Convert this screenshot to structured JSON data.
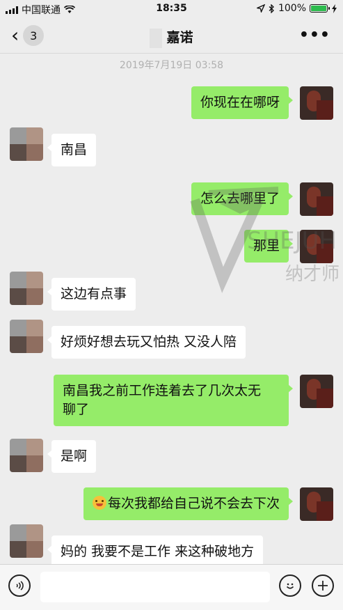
{
  "status_bar": {
    "carrier": "中国联通",
    "time": "18:35",
    "battery": "100%",
    "icons": [
      "signal-icon",
      "wifi-icon",
      "location-icon",
      "bluetooth-icon",
      "battery-icon",
      "charging-icon"
    ]
  },
  "nav": {
    "back_count": "3",
    "title": "嘉诺",
    "more": "•••"
  },
  "chat": {
    "timestamp": "2019年7月19日 03:58",
    "messages": [
      {
        "from": "me",
        "text": "你现在在哪呀"
      },
      {
        "from": "other",
        "text": "南昌"
      },
      {
        "from": "me",
        "text": "怎么去哪里了"
      },
      {
        "from": "me",
        "text": "那里"
      },
      {
        "from": "other",
        "text": "这边有点事"
      },
      {
        "from": "other",
        "text": "好烦好想去玩又怕热 又没人陪"
      },
      {
        "from": "me",
        "text_line1": "南昌我之前工作连着去了几次太无",
        "text_line2": "聊了"
      },
      {
        "from": "other",
        "text": "是啊"
      },
      {
        "from": "me",
        "emoji": "smiley-emoji",
        "text": "每次我都给自己说不会去下次"
      },
      {
        "from": "other",
        "text": "妈的 我要不是工作 来这种破地方"
      }
    ]
  },
  "watermark": {
    "text_en": "SHEJUH",
    "text_cn": "纳才师"
  },
  "input_bar": {
    "placeholder": "",
    "icons": [
      "voice-icon",
      "emoji-icon",
      "plus-icon"
    ]
  },
  "colors": {
    "background": "#ededed",
    "bubble_me": "#95ec69",
    "bubble_other": "#ffffff",
    "timestamp": "#b0b0b0",
    "battery_fill": "#2dbb4e"
  }
}
